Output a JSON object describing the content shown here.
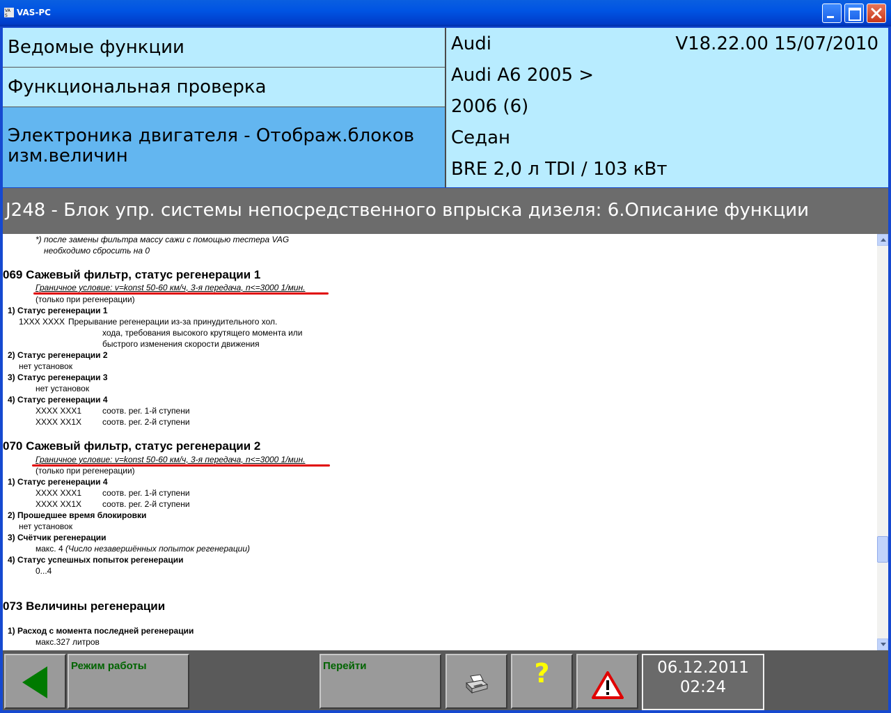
{
  "window": {
    "title": "VAS-PC",
    "icon": "vas-app-icon",
    "controls": [
      "minimize-icon",
      "maximize-icon",
      "close-icon"
    ]
  },
  "left_panel": {
    "row1": "Ведомые функции",
    "row2": "Функциональная проверка",
    "row3_line1": "Электроника двигателя - Отображ.блоков",
    "row3_line2": "изм.величин"
  },
  "vehicle": {
    "make": "Audi",
    "version": "V18.22.00 15/07/2010",
    "model": "Audi A6 2005 >",
    "year": "2006 (6)",
    "body": "Седан",
    "engine": "BRE 2,0 л TDI / 103 кВт"
  },
  "header": {
    "title": "J248 - Блок упр. системы непосредственного впрыска дизеля: 6.Описание функции"
  },
  "document": {
    "note_line1": "*) после замены фильтра массу сажи с помощью тестера VAG",
    "note_line2": "необходимо сбросить на 0",
    "s069": {
      "title": "069 Сажевый фильтр, статус регенерации 1",
      "condition": "Граничное условие: v=konst 50-60 км/ч, 3-я передача, n<=3000 1/мин.",
      "only_regen": "(только при регенерации)",
      "i1": "1) Статус регенерации 1",
      "i1_code": "1XXX XXXX",
      "i1_desc1": "Прерывание регенерации из-за принудительного хол.",
      "i1_desc2": "хода, требования высокого крутящего момента или",
      "i1_desc3": "быстрого изменения скорости движения",
      "i2": "2) Статус регенерации 2",
      "i2_val": "нет установок",
      "i3": "3) Статус регенерации 3",
      "i3_val": "нет установок",
      "i4": "4) Статус регенерации 4",
      "i4_code1": "XXXX XXX1",
      "i4_desc1": "соотв. рег. 1-й ступени",
      "i4_code2": "XXXX XX1X",
      "i4_desc2": "соотв. рег. 2-й ступени"
    },
    "s070": {
      "title": "070 Сажевый фильтр, статус регенерации 2",
      "condition": "Граничное условие: v=konst 50-60 км/ч, 3-я передача, n<=3000 1/мин.",
      "only_regen": "(только при регенерации)",
      "i1": "1) Статус регенерации 4",
      "i1_code1": "XXXX XXX1",
      "i1_desc1": "соотв. рег. 1-й ступени",
      "i1_code2": "XXXX XX1X",
      "i1_desc2": "соотв. рег. 2-й ступени",
      "i2": "2) Прошедшее время блокировки",
      "i2_val": "нет установок",
      "i3": "3) Счётчик регенерации",
      "i3_val": "макс. 4",
      "i3_note": "(Число незавершённых попыток регенерации)",
      "i4": "4) Статус успешных попыток регенерации",
      "i4_val": "0...4"
    },
    "s073": {
      "title": "073 Величины регенерации",
      "i1": "1) Расход с момента последней регенерации",
      "i1_val": "макс.327 литров"
    }
  },
  "toolbar": {
    "mode_label": "Режим работы",
    "goto_label": "Перейти",
    "help_glyph": "?",
    "date": "06.12.2011",
    "time": "02:24",
    "colors": {
      "accent_green": "#006400",
      "help_yellow": "#ffff00",
      "warning_red": "#e00000"
    }
  }
}
